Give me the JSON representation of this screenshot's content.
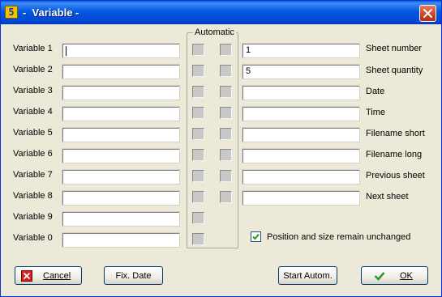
{
  "window": {
    "title": "-  Variable -",
    "app_icon_glyph": "5"
  },
  "variables": {
    "labels": [
      "Variable 1",
      "Variable 2",
      "Variable 3",
      "Variable 4",
      "Variable 5",
      "Variable 6",
      "Variable 7",
      "Variable 8",
      "Variable 9",
      "Variable 0"
    ],
    "values": [
      "",
      "",
      "",
      "",
      "",
      "",
      "",
      "",
      "",
      ""
    ]
  },
  "automatic": {
    "group_label": "Automatic"
  },
  "auto_fields": {
    "labels": [
      "Sheet number",
      "Sheet quantity",
      "Date",
      "Time",
      "Filename short",
      "Filename long",
      "Previous sheet",
      "Next sheet"
    ],
    "values": [
      "1",
      "5",
      "",
      "",
      "",
      "",
      "",
      ""
    ]
  },
  "options": {
    "keep_position_label": "Position and size remain unchanged",
    "keep_position_checked": true
  },
  "buttons": {
    "cancel_label": "Cancel",
    "fix_date_label": "Fix. Date",
    "start_autom_label": "Start Autom.",
    "ok_label": "OK"
  },
  "colors": {
    "titlebar": "#0458e2",
    "close_button": "#c8442a",
    "cancel_icon": "#d42020",
    "ok_icon": "#2a9a2a",
    "checkbox_mark": "#21a121"
  }
}
